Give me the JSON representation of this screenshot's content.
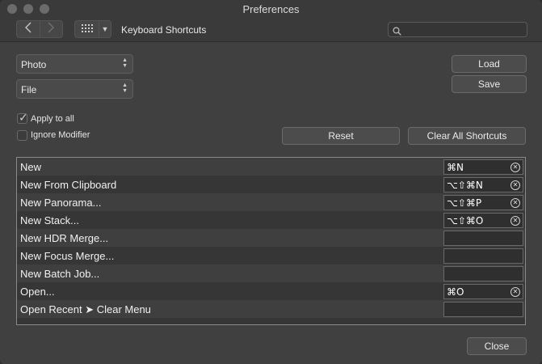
{
  "window": {
    "title": "Preferences"
  },
  "toolbar": {
    "title": "Keyboard Shortcuts",
    "search_placeholder": ""
  },
  "selects": {
    "persona": "Photo",
    "category": "File"
  },
  "buttons": {
    "load": "Load",
    "save": "Save",
    "reset": "Reset",
    "clear_all": "Clear All Shortcuts",
    "close": "Close"
  },
  "options": {
    "apply_to_all": {
      "label": "Apply to all",
      "checked": true
    },
    "ignore_modifier": {
      "label": "Ignore Modifier",
      "checked": false
    }
  },
  "shortcuts": [
    {
      "label": "New",
      "shortcut": "⌘N"
    },
    {
      "label": "New From Clipboard",
      "shortcut": "⌥⇧⌘N"
    },
    {
      "label": "New Panorama...",
      "shortcut": "⌥⇧⌘P"
    },
    {
      "label": "New Stack...",
      "shortcut": "⌥⇧⌘O"
    },
    {
      "label": "New HDR Merge...",
      "shortcut": ""
    },
    {
      "label": "New Focus Merge...",
      "shortcut": ""
    },
    {
      "label": "New Batch Job...",
      "shortcut": ""
    },
    {
      "label": "Open...",
      "shortcut": "⌘O"
    },
    {
      "label": "Open Recent ➤ Clear Menu",
      "shortcut": ""
    }
  ],
  "icons": {
    "back": "chevron-left-icon",
    "forward": "chevron-right-icon",
    "grid": "grid-icon",
    "dropdown": "triangle-down-icon",
    "search": "search-icon",
    "clear": "circle-x-icon"
  }
}
